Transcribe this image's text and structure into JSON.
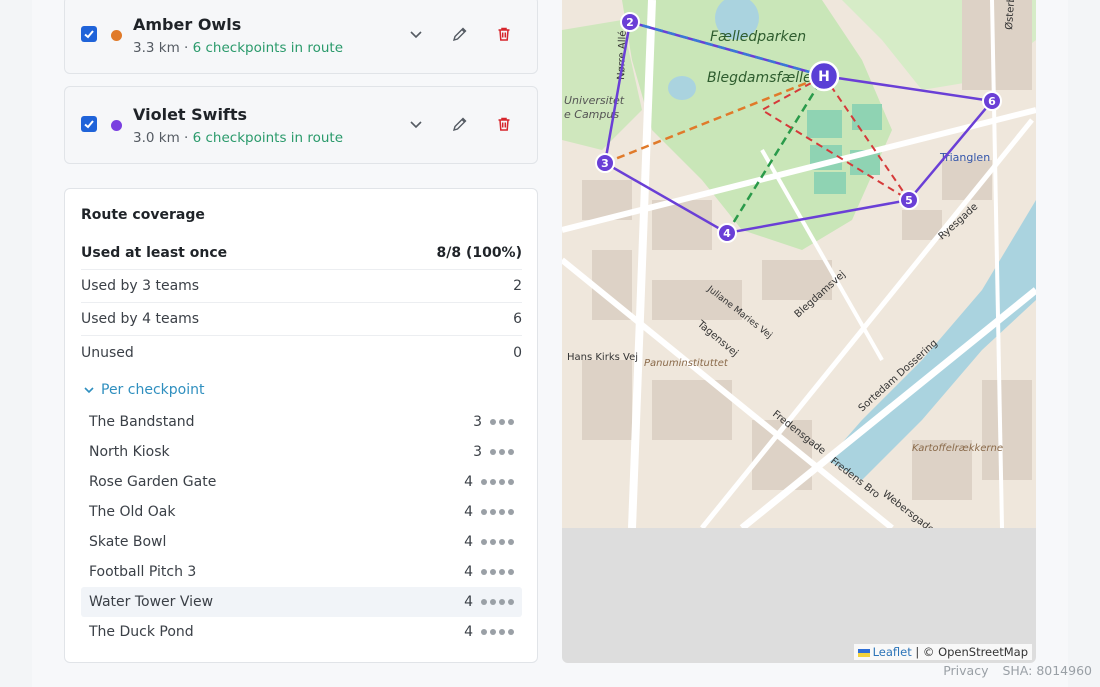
{
  "teams": [
    {
      "name": "Amber Owls",
      "distance": "3.3 km",
      "separator": " · ",
      "checkpoints": "6 checkpoints in route",
      "color": "#e07a2a"
    },
    {
      "name": "Violet Swifts",
      "distance": "3.0 km",
      "separator": " · ",
      "checkpoints": "6 checkpoints in route",
      "color": "#7a3fe0"
    }
  ],
  "coverage": {
    "title": "Route coverage",
    "rows": [
      {
        "label": "Used at least once",
        "value": "8/8 (100%)"
      },
      {
        "label": "Used by 3 teams",
        "value": "2"
      },
      {
        "label": "Used by 4 teams",
        "value": "6"
      },
      {
        "label": "Unused",
        "value": "0"
      }
    ],
    "per_checkpoint_label": "Per checkpoint",
    "checkpoints": [
      {
        "name": "The Bandstand",
        "count": "3",
        "dots": 3
      },
      {
        "name": "North Kiosk",
        "count": "3",
        "dots": 3
      },
      {
        "name": "Rose Garden Gate",
        "count": "4",
        "dots": 4
      },
      {
        "name": "The Old Oak",
        "count": "4",
        "dots": 4
      },
      {
        "name": "Skate Bowl",
        "count": "4",
        "dots": 4
      },
      {
        "name": "Football Pitch 3",
        "count": "4",
        "dots": 4
      },
      {
        "name": "Water Tower View",
        "count": "4",
        "dots": 4
      },
      {
        "name": "The Duck Pond",
        "count": "4",
        "dots": 4
      }
    ]
  },
  "map": {
    "labels": {
      "faelledparken": "Fælledparken",
      "blegdamsfaelled": "Blegdamsfælled",
      "trianglen": "Trianglen",
      "panum": "Panuminstituttet",
      "kartoffel": "Kartoffelrækkerne",
      "fredensgade": "Fredensgade",
      "blegdamsvej": "Blegdamsvej",
      "norre_alle": "Nørre Allé",
      "sortedam": "Sortedam Dossering",
      "webersgade": "Webersgade",
      "ryesgade": "Ryesgade",
      "tagensvej": "Tagensvej",
      "universitet": "Universitet",
      "campus": "e Campus",
      "hans_kirks": "Hans Kirks Vej",
      "julius": "Juliane Maries Vej",
      "osterbro": "Østerbro",
      "fredens_bro": "Fredens Bro"
    },
    "markers": [
      {
        "label": "2"
      },
      {
        "label": "3"
      },
      {
        "label": "4"
      },
      {
        "label": "5"
      },
      {
        "label": "6"
      },
      {
        "label": "H"
      }
    ],
    "attribution": {
      "leaflet": "Leaflet",
      "separator": " | © ",
      "osm": "OpenStreetMap"
    }
  },
  "footer": {
    "privacy": "Privacy",
    "sha": "SHA: 8014960"
  }
}
